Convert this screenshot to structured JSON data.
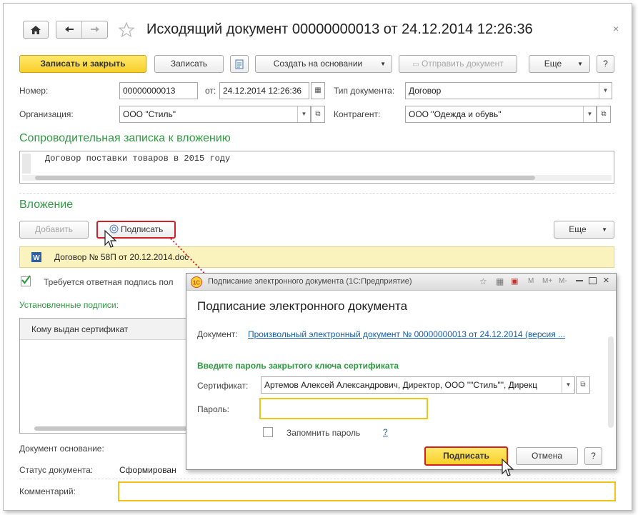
{
  "window": {
    "title": "Исходящий документ 00000000013 от 24.12.2014 12:26:36",
    "close_glyph": "×"
  },
  "toolbar": {
    "save_close_label": "Записать и закрыть",
    "save_label": "Записать",
    "create_based_label": "Создать на основании",
    "send_label": "Отправить документ",
    "more_label": "Еще",
    "help_label": "?"
  },
  "header_fields": {
    "number_label": "Номер:",
    "number_value": "00000000013",
    "date_label": "от:",
    "date_value": "24.12.2014 12:26:36",
    "doctype_label": "Тип документа:",
    "doctype_value": "Договор",
    "org_label": "Организация:",
    "org_value": "ООО \"Стиль\"",
    "counterparty_label": "Контрагент:",
    "counterparty_value": "ООО \"Одежда и обувь\""
  },
  "note_section": {
    "title": "Сопроводительная записка к вложению",
    "text": "Договор поставки товаров в 2015 году"
  },
  "attachment_section": {
    "title": "Вложение",
    "add_label": "Добавить",
    "sign_label": "Подписать",
    "more_label": "Еще",
    "file_name": "Договор № 58П от 20.12.2014.doc",
    "require_reply_sign_label": "Требуется ответная подпись пол",
    "require_reply_sign_checked": true,
    "signatures_title": "Установленные подписи:",
    "signatures_column": "Кому выдан сертификат"
  },
  "footer_fields": {
    "base_doc_label": "Документ основание:",
    "status_label": "Статус документа:",
    "status_value": "Сформирован",
    "comment_label": "Комментарий:",
    "comment_value": ""
  },
  "dialog": {
    "window_title": "Подписание электронного документа  (1С:Предприятие)",
    "heading": "Подписание электронного документа",
    "doc_label": "Документ:",
    "doc_link": "Произвольный электронный документ № 00000000013 от 24.12.2014 (версия ...",
    "password_prompt": "Введите пароль закрытого ключа сертификата",
    "cert_label": "Сертификат:",
    "cert_value": "Артемов Алексей Александрович, Директор, ООО \"\"Стиль\"\", Дирекц",
    "password_label": "Пароль:",
    "password_value": "",
    "remember_label": "Запомнить пароль",
    "remember_checked": false,
    "remember_help": "?",
    "sign_label": "Подписать",
    "cancel_label": "Отмена",
    "help_label": "?",
    "title_buttons": [
      "M",
      "M+",
      "M-"
    ]
  },
  "colors": {
    "accent_green": "#2f9a41",
    "primary_yellow": "#f7cf2a",
    "highlight_red": "#d0202a",
    "link_blue": "#1a5ea8"
  }
}
